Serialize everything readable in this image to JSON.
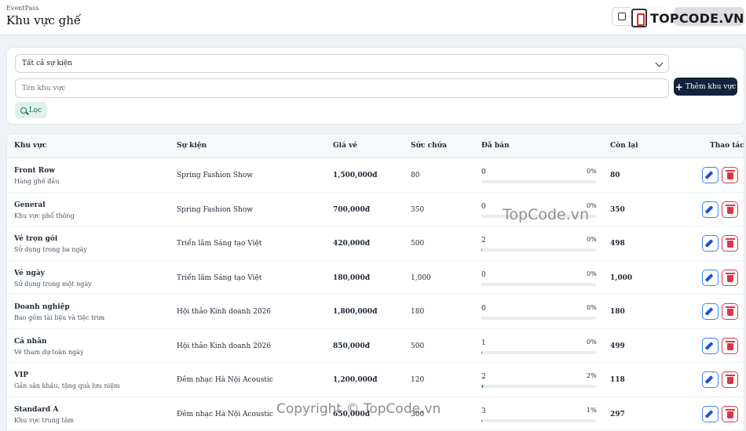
{
  "header": {
    "brand": "EventPass",
    "title": "Khu vực ghế",
    "logo_text": "TOPCODE.VN"
  },
  "filters": {
    "event_select": "Tất cả sự kiện",
    "name_placeholder": "Tên khu vực",
    "add_label": "Thêm khu vực",
    "filter_label": "Lọc"
  },
  "table": {
    "headers": {
      "zone": "Khu vực",
      "event": "Sự kiện",
      "price": "Giá vé",
      "capacity": "Sức chứa",
      "sold": "Đã bán",
      "remaining": "Còn lại",
      "actions": "Thao tác"
    },
    "rows": [
      {
        "name": "Front Row",
        "desc": "Hàng ghế đầu",
        "event": "Spring Fashion Show",
        "price": "1,500,000đ",
        "capacity": "80",
        "sold": "0",
        "pct": "0%",
        "fill": 0,
        "remaining": "80"
      },
      {
        "name": "General",
        "desc": "Khu vực phổ thông",
        "event": "Spring Fashion Show",
        "price": "700,000đ",
        "capacity": "350",
        "sold": "0",
        "pct": "0%",
        "fill": 0,
        "remaining": "350"
      },
      {
        "name": "Vé trọn gói",
        "desc": "Sử dụng trong ba ngày",
        "event": "Triển lãm Sáng tạo Việt",
        "price": "420,000đ",
        "capacity": "500",
        "sold": "2",
        "pct": "0%",
        "fill": 0.4,
        "remaining": "498"
      },
      {
        "name": "Vé ngày",
        "desc": "Sử dụng trong một ngày",
        "event": "Triển lãm Sáng tạo Việt",
        "price": "180,000đ",
        "capacity": "1,000",
        "sold": "0",
        "pct": "0%",
        "fill": 0,
        "remaining": "1,000"
      },
      {
        "name": "Doanh nghiệp",
        "desc": "Bao gồm tài liệu và tiệc trưa",
        "event": "Hội thảo Kinh doanh 2026",
        "price": "1,800,000đ",
        "capacity": "180",
        "sold": "0",
        "pct": "0%",
        "fill": 0,
        "remaining": "180"
      },
      {
        "name": "Cá nhân",
        "desc": "Vé tham dự toàn ngày",
        "event": "Hội thảo Kinh doanh 2026",
        "price": "850,000đ",
        "capacity": "500",
        "sold": "1",
        "pct": "0%",
        "fill": 0.2,
        "remaining": "499"
      },
      {
        "name": "VIP",
        "desc": "Gần sân khấu, tặng quà lưu niệm",
        "event": "Đêm nhạc Hà Nội Acoustic",
        "price": "1,200,000đ",
        "capacity": "120",
        "sold": "2",
        "pct": "2%",
        "fill": 1.7,
        "remaining": "118"
      },
      {
        "name": "Standard A",
        "desc": "Khu vực trung tâm",
        "event": "Đêm nhạc Hà Nội Acoustic",
        "price": "650,000đ",
        "capacity": "300",
        "sold": "3",
        "pct": "1%",
        "fill": 1,
        "remaining": "297"
      }
    ]
  },
  "watermarks": {
    "mid": "TopCode.vn",
    "bottom": "Copyright © TopCode.vn"
  },
  "colors": {
    "primary": "#13233c",
    "progress": "#2f8f7a",
    "edit": "#3b82f6",
    "delete": "#dc3545",
    "filter_bg": "#dff1ea"
  }
}
